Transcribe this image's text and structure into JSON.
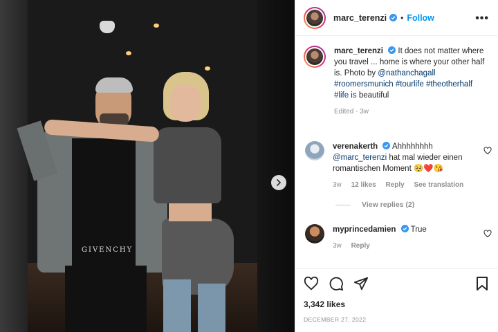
{
  "post": {
    "username": "marc_terenzi",
    "follow_label": "Follow",
    "dot": "•",
    "more_label": "•••",
    "shirt_print": "GIVENCHY",
    "caption": {
      "username": "marc_terenzi",
      "text_start": "It does not matter where you travel ... home is where your other half is. Photo by",
      "mention": "@nathanchagall",
      "hashtags": "#roomersmunich #tourlife #theotherhalf #life is",
      "text_end": "beautiful",
      "meta": "Edited · 3w"
    },
    "comments": [
      {
        "username": "verenakerth",
        "text_start": "Ahhhhhhhh",
        "mention": "@marc_terenzi",
        "text_end": "hat mal wieder einen romantischen Moment 🥺❤️😘",
        "time": "3w",
        "likes": "12 likes",
        "reply": "Reply",
        "translate": "See translation",
        "view_replies": "View replies (2)"
      },
      {
        "username": "myprincedamien",
        "text": "True",
        "time": "3w",
        "reply": "Reply"
      }
    ],
    "likes": "3,342 likes",
    "date": "DECEMBER 27, 2022"
  },
  "icons": {
    "verified": "verified-badge-icon",
    "heart": "heart-icon",
    "comment": "comment-icon",
    "share": "share-icon",
    "bookmark": "bookmark-icon",
    "next": "chevron-right-icon"
  },
  "colors": {
    "link": "#00376b",
    "follow": "#0095f6",
    "verified": "#3897f0",
    "muted": "#8e8e8e"
  }
}
